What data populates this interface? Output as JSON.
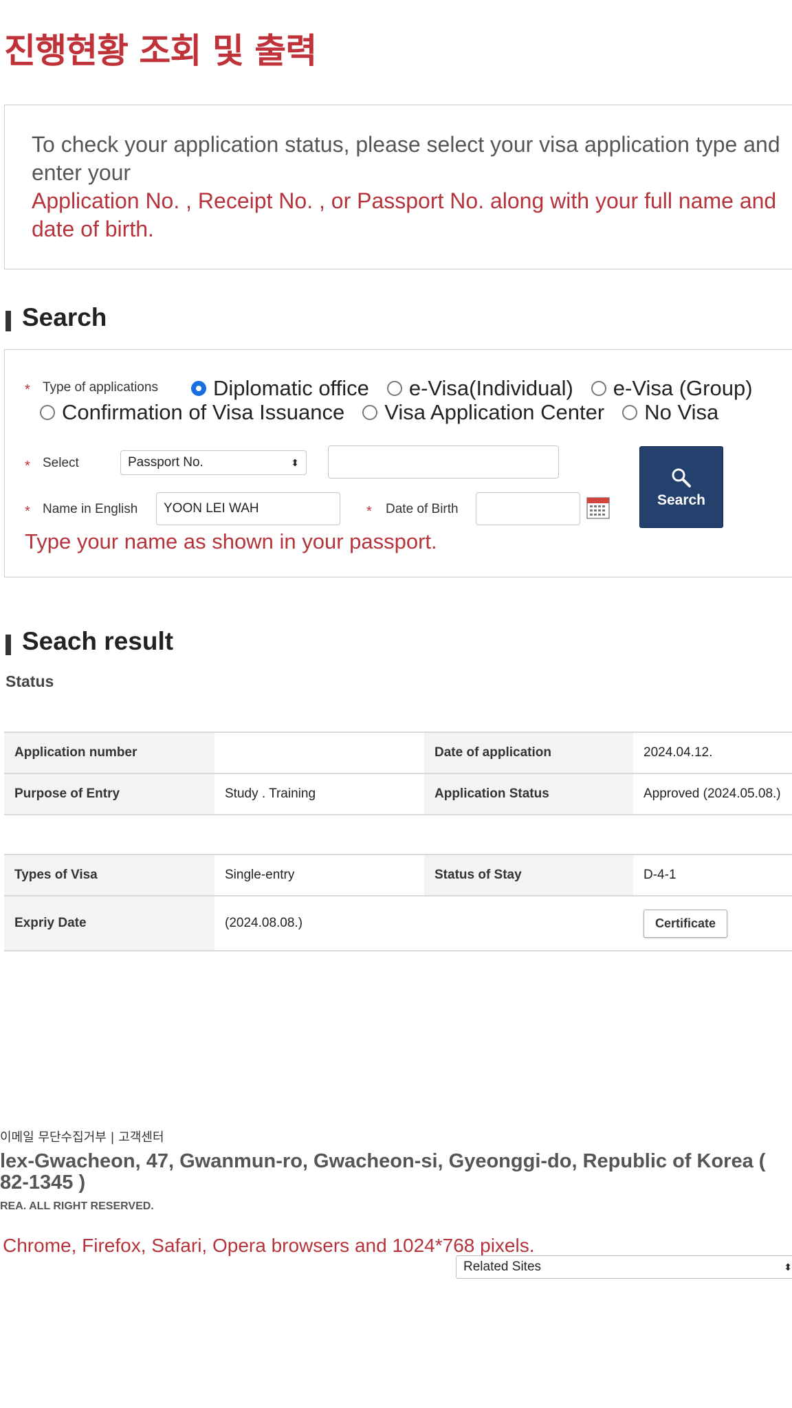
{
  "page_title": "진행현황 조회 및 출력",
  "notice": {
    "line1": "To check your application status, please select your visa application type and",
    "line2": "enter your",
    "line3": "Application No. , Receipt No. , or Passport No. along with your full name and",
    "line4": "date of birth."
  },
  "search_section": {
    "title": "Search",
    "type_label": "Type of applications",
    "options": [
      {
        "label": "Diplomatic office",
        "selected": true
      },
      {
        "label": "e-Visa(Individual)",
        "selected": false
      },
      {
        "label": "e-Visa (Group)",
        "selected": false
      },
      {
        "label": "Confirmation of Visa Issuance",
        "selected": false
      },
      {
        "label": "Visa Application Center",
        "selected": false
      },
      {
        "label": "No Visa",
        "selected": false
      }
    ],
    "select_label": "Select",
    "select_value": "Passport No.",
    "search_value": "",
    "name_label": "Name in English",
    "name_value": "YOON LEI WAH",
    "dob_label": "Date of Birth",
    "dob_value": "",
    "search_button": "Search",
    "hint": "Type your name as shown in your passport."
  },
  "result_section": {
    "title": "Seach result",
    "status_label": "Status",
    "table1": [
      [
        "Application number",
        "",
        "Date of application",
        "2024.04.12."
      ],
      [
        "Purpose of Entry",
        "Study . Training",
        "Application Status",
        "Approved (2024.05.08.)"
      ]
    ],
    "table2": [
      [
        "Types of Visa",
        "Single-entry",
        "Status of Stay",
        "D-4-1"
      ],
      [
        "Expriy Date",
        "(2024.08.08.)",
        "",
        ""
      ]
    ],
    "certificate_button": "Certificate"
  },
  "footer": {
    "links": "이메일 무단수집거부  |  고객센터",
    "address_line1": "lex-Gwacheon, 47, Gwanmun-ro, Gwacheon-si, Gyeonggi-do, Republic of Korea (",
    "address_line2": "82-1345 )",
    "copyright": "REA. ALL RIGHT RESERVED.",
    "browser_note": "Chrome, Firefox, Safari, Opera browsers and 1024*768 pixels.",
    "related_sites": "Related Sites"
  },
  "colors": {
    "accent_red": "#c0323a",
    "button_navy": "#24406c",
    "radio_blue": "#1a6fe0"
  }
}
